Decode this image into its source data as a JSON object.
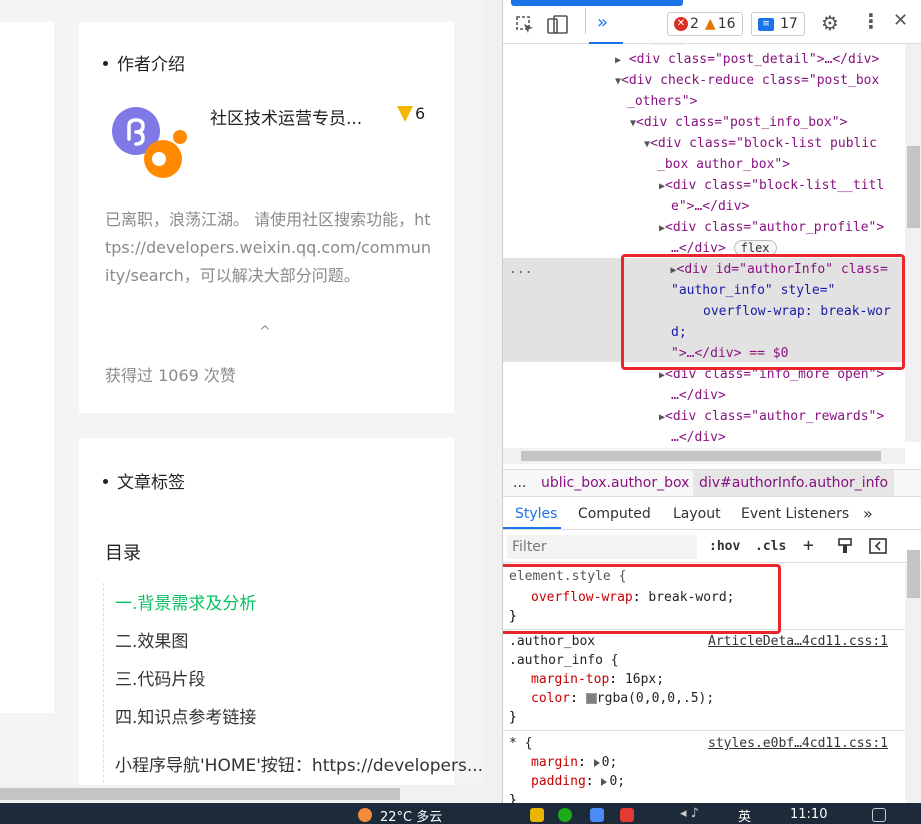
{
  "left_page": {
    "author_card": {
      "title": "作者介绍",
      "author_name": "社区技术运营专员...",
      "level": "6",
      "bio": "已离职，浪荡江湖。 请使用社区搜索功能，https://developers.weixin.qq.com/community/search，可以解决大部分问题。",
      "collapse_icon": "chevron-up",
      "likes": "获得过 1069 次赞"
    },
    "tags_card": {
      "title": "文章标签"
    },
    "toc": {
      "title": "目录",
      "items": [
        "一.背景需求及分析",
        "二.效果图",
        "三.代码片段",
        "四.知识点参考链接",
        "小程序导航'HOME'按钮：https://developers..."
      ]
    }
  },
  "devtools": {
    "toolbar": {
      "errors": "2",
      "warnings": "16",
      "messages": "17"
    },
    "dom_tree": [
      {
        "tag": "div",
        "attrs": [
          [
            "class",
            "post_detail"
          ]
        ],
        "suffix": "…</div>"
      },
      {
        "tag": "div",
        "attrs": [
          [
            "class",
            "post_box _others"
          ]
        ],
        "prefix_attr": "check-reduce"
      },
      {
        "tag": "div",
        "attrs": [
          [
            "class",
            "post_info_box"
          ]
        ]
      },
      {
        "tag": "div",
        "attrs": [
          [
            "class",
            "block-list public_box author_box"
          ]
        ]
      },
      {
        "tag": "div",
        "attrs": [
          [
            "class",
            "block-list__title"
          ]
        ],
        "suffix": "…</div>"
      },
      {
        "tag": "div",
        "attrs": [
          [
            "class",
            "author_profile"
          ]
        ],
        "suffix": "…</div>",
        "badge": "flex"
      },
      {
        "tag": "div",
        "attrs": [
          [
            "id",
            "authorInfo"
          ],
          [
            "class",
            "author_info"
          ],
          [
            "style",
            "overflow-wrap: break-word;"
          ]
        ],
        "suffix": "…</div>",
        "eq": "== $0"
      },
      {
        "tag": "div",
        "attrs": [
          [
            "class",
            "info_more open"
          ]
        ],
        "suffix": "…</div>"
      },
      {
        "tag": "div",
        "attrs": [
          [
            "class",
            "author_rewards"
          ]
        ],
        "suffix": "…</div>"
      }
    ],
    "dom_lines": [
      "<div class=\"post_detail\">…</div>",
      "<div check-reduce class=\"post_box",
      "_others\">",
      "<div class=\"post_info_box\">",
      "<div class=\"block-list public",
      "_box author_box\">",
      "<div class=\"block-list__titl",
      "e\">…</div>",
      "<div class=\"author_profile\">",
      "…</div>",
      "<div id=\"authorInfo\" class=",
      "\"author_info\" style=\"",
      "overflow-wrap: break-wor",
      "d;",
      "\">…</div> == $0",
      "<div class=\"info_more open\">",
      "…</div>",
      "<div class=\"author_rewards\">",
      "…</div>"
    ],
    "dom_badge": "flex",
    "ellipsis": "...",
    "breadcrumbs": {
      "more": "...",
      "first": "ublic_box.author_box",
      "second": "div#authorInfo.author_info"
    },
    "tabs": [
      "Styles",
      "Computed",
      "Layout",
      "Event Listeners",
      "»"
    ],
    "filter": {
      "placeholder": "Filter",
      "hov": ":hov",
      "cls": ".cls",
      "plus": "+"
    },
    "styles": {
      "element_style": {
        "selector": "element.style {",
        "prop": "overflow-wrap",
        "value": "break-word;",
        "close": "}"
      },
      "author_rule": {
        "selector1": ".author_box",
        "selector2": ".author_info {",
        "source": "ArticleDeta…4cd11.css:1",
        "prop1": "margin-top",
        "value1": "16px;",
        "prop2": "color",
        "value2": "rgba(0,0,0,.5);",
        "close": "}"
      },
      "star_rule": {
        "selector": "* {",
        "source": "styles.e0bf…4cd11.css:1",
        "prop1": "margin",
        "value1": "0;",
        "prop2": "padding",
        "value2": "0;",
        "close": "}"
      }
    }
  },
  "taskbar": {
    "weather": "22°C  多云",
    "ime": "英",
    "time": "11:10"
  },
  "colors": {
    "accent": "#1a73e8",
    "active_toc": "#07c160",
    "highlight_box": "#e8262b"
  }
}
